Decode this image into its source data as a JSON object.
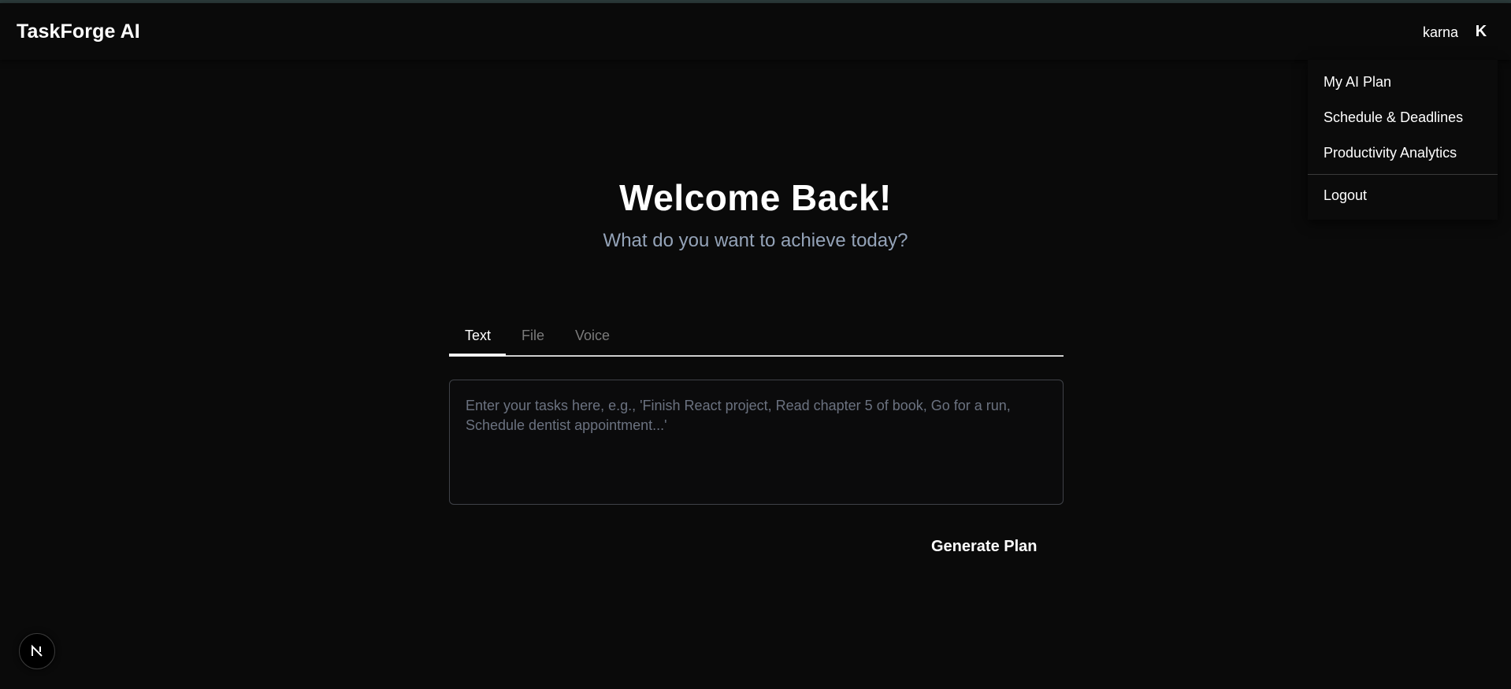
{
  "header": {
    "app_title": "TaskForge AI",
    "username": "karna",
    "avatar_initial": "K"
  },
  "menu": {
    "items": [
      {
        "label": "My AI Plan"
      },
      {
        "label": "Schedule & Deadlines"
      },
      {
        "label": "Productivity Analytics"
      }
    ],
    "logout_label": "Logout"
  },
  "main": {
    "title": "Welcome Back!",
    "subtitle": "What do you want to achieve today?",
    "tabs": [
      {
        "label": "Text",
        "active": true
      },
      {
        "label": "File",
        "active": false
      },
      {
        "label": "Voice",
        "active": false
      }
    ],
    "task_input": {
      "value": "",
      "placeholder": "Enter your tasks here, e.g., 'Finish React project, Read chapter 5 of book, Go for a run, Schedule dentist appointment...'"
    },
    "generate_label": "Generate Plan"
  },
  "dev_badge": {
    "icon": "nextjs-logo-icon"
  },
  "colors": {
    "background": "#0a0a0a",
    "subtitle": "#94a3b8",
    "inactive_tab": "#7b7b7b",
    "input_border": "#3f4248"
  }
}
